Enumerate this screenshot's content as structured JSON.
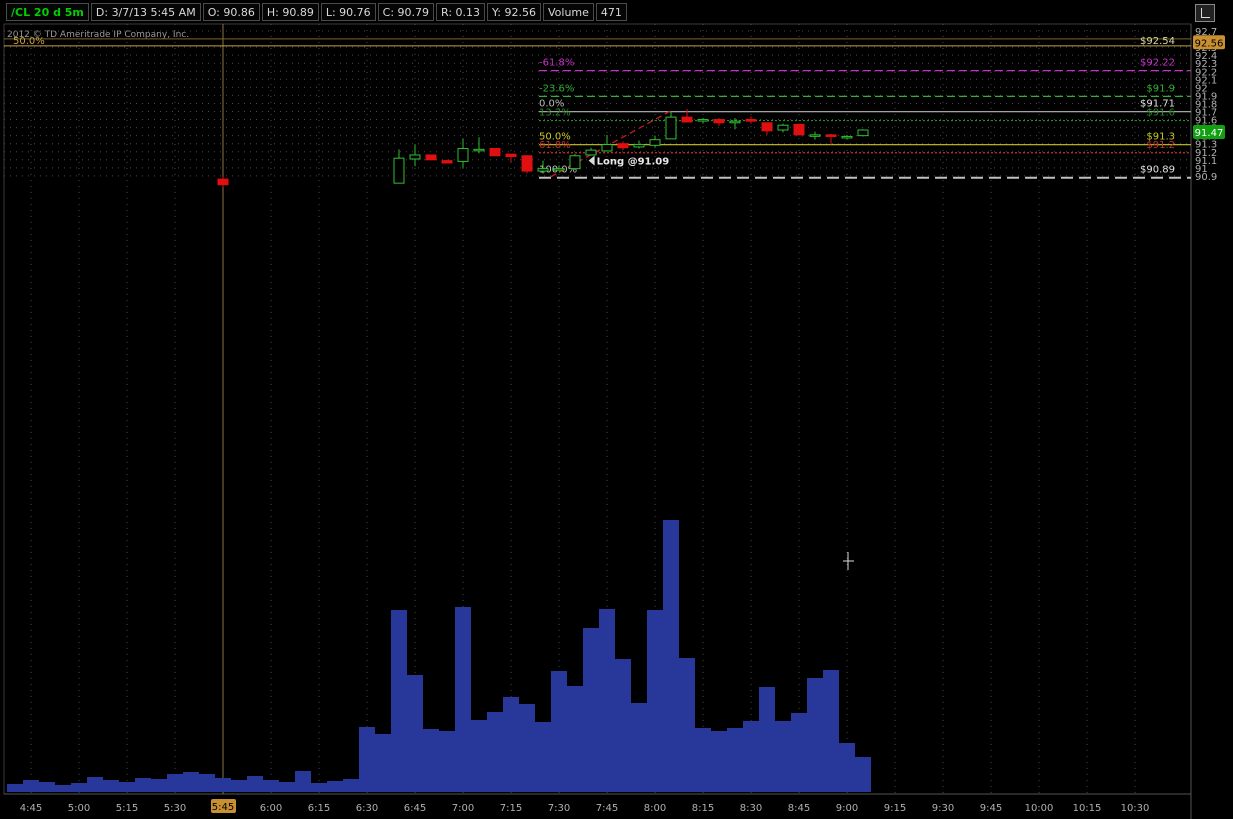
{
  "topbar": {
    "symbol": "/CL 20 d 5m",
    "date": "D: 3/7/13 5:45 AM",
    "open": "O: 90.86",
    "high": "H: 90.89",
    "low": "L: 90.76",
    "close": "C: 90.79",
    "range": "R: 0.13",
    "y": "Y: 92.56",
    "volume_label": "Volume",
    "volume_value": "471"
  },
  "copyright": "2012 © TD Ameritrade IP Company, Inc.",
  "chart_data": {
    "type": "candlestick",
    "price_range": [
      90.81,
      92.72
    ],
    "y_ticks": [
      "92.7",
      "92.6",
      "92.5",
      "92.4",
      "92.3",
      "92.2",
      "92.1",
      "92",
      "91.9",
      "91.8",
      "91.7",
      "91.6",
      "91.5",
      "91.4",
      "91.3",
      "91.2",
      "91.1",
      "91",
      "90.9"
    ],
    "x_ticks": [
      "4:45",
      "5:00",
      "5:15",
      "5:30",
      "5:45",
      "6:00",
      "6:15",
      "6:30",
      "6:45",
      "7:00",
      "7:15",
      "7:30",
      "7:45",
      "8:00",
      "8:15",
      "8:30",
      "8:45",
      "9:00",
      "9:15",
      "9:30",
      "9:45",
      "10:00",
      "10:15",
      "10:30"
    ],
    "cursor_time_label": "5:45",
    "candles": [
      {
        "time": "5:45",
        "o": 90.86,
        "h": 90.89,
        "l": 90.76,
        "c": 90.79
      },
      {
        "time": "6:40",
        "o": 90.81,
        "h": 91.23,
        "l": 90.81,
        "c": 91.12
      },
      {
        "time": "6:45",
        "o": 91.11,
        "h": 91.29,
        "l": 91.02,
        "c": 91.16
      },
      {
        "time": "6:50",
        "o": 91.16,
        "h": 91.16,
        "l": 91.1,
        "c": 91.1
      },
      {
        "time": "6:55",
        "o": 91.09,
        "h": 91.1,
        "l": 91.06,
        "c": 91.06
      },
      {
        "time": "7:00",
        "o": 91.08,
        "h": 91.36,
        "l": 91.0,
        "c": 91.24
      },
      {
        "time": "7:05",
        "o": 91.22,
        "h": 91.38,
        "l": 91.18,
        "c": 91.23
      },
      {
        "time": "7:10",
        "o": 91.24,
        "h": 91.24,
        "l": 91.15,
        "c": 91.15
      },
      {
        "time": "7:15",
        "o": 91.17,
        "h": 91.17,
        "l": 91.07,
        "c": 91.14
      },
      {
        "time": "7:20",
        "o": 91.15,
        "h": 91.16,
        "l": 90.93,
        "c": 90.96
      },
      {
        "time": "7:25",
        "o": 90.96,
        "h": 91.09,
        "l": 90.93,
        "c": 90.99
      },
      {
        "time": "7:30",
        "o": 90.99,
        "h": 91.03,
        "l": 90.97,
        "c": 90.99
      },
      {
        "time": "7:35",
        "o": 90.99,
        "h": 91.17,
        "l": 90.99,
        "c": 91.15
      },
      {
        "time": "7:40",
        "o": 91.16,
        "h": 91.25,
        "l": 91.16,
        "c": 91.22
      },
      {
        "time": "7:45",
        "o": 91.21,
        "h": 91.41,
        "l": 91.21,
        "c": 91.29
      },
      {
        "time": "7:50",
        "o": 91.3,
        "h": 91.33,
        "l": 91.22,
        "c": 91.25
      },
      {
        "time": "7:55",
        "o": 91.26,
        "h": 91.34,
        "l": 91.24,
        "c": 91.29
      },
      {
        "time": "8:00",
        "o": 91.28,
        "h": 91.4,
        "l": 91.25,
        "c": 91.35
      },
      {
        "time": "8:05",
        "o": 91.36,
        "h": 91.7,
        "l": 91.36,
        "c": 91.63
      },
      {
        "time": "8:10",
        "o": 91.63,
        "h": 91.73,
        "l": 91.57,
        "c": 91.57
      },
      {
        "time": "8:15",
        "o": 91.59,
        "h": 91.62,
        "l": 91.55,
        "c": 91.6
      },
      {
        "time": "8:20",
        "o": 91.6,
        "h": 91.62,
        "l": 91.52,
        "c": 91.56
      },
      {
        "time": "8:25",
        "o": 91.56,
        "h": 91.62,
        "l": 91.48,
        "c": 91.58
      },
      {
        "time": "8:30",
        "o": 91.6,
        "h": 91.64,
        "l": 91.55,
        "c": 91.58
      },
      {
        "time": "8:35",
        "o": 91.56,
        "h": 91.56,
        "l": 91.41,
        "c": 91.46
      },
      {
        "time": "8:40",
        "o": 91.47,
        "h": 91.55,
        "l": 91.44,
        "c": 91.53
      },
      {
        "time": "8:45",
        "o": 91.54,
        "h": 91.55,
        "l": 91.41,
        "c": 91.41
      },
      {
        "time": "8:50",
        "o": 91.4,
        "h": 91.45,
        "l": 91.35,
        "c": 91.41
      },
      {
        "time": "8:55",
        "o": 91.41,
        "h": 91.42,
        "l": 91.29,
        "c": 91.39
      },
      {
        "time": "9:00",
        "o": 91.39,
        "h": 91.41,
        "l": 91.35,
        "c": 91.39
      },
      {
        "time": "9:05",
        "o": 91.4,
        "h": 91.48,
        "l": 91.39,
        "c": 91.47
      }
    ],
    "volume_bars": [
      {
        "time": "4:40",
        "v": 8
      },
      {
        "time": "4:45",
        "v": 12
      },
      {
        "time": "4:50",
        "v": 10
      },
      {
        "time": "4:55",
        "v": 7
      },
      {
        "time": "5:00",
        "v": 9
      },
      {
        "time": "5:05",
        "v": 15
      },
      {
        "time": "5:10",
        "v": 12
      },
      {
        "time": "5:15",
        "v": 10
      },
      {
        "time": "5:20",
        "v": 14
      },
      {
        "time": "5:25",
        "v": 13
      },
      {
        "time": "5:30",
        "v": 18
      },
      {
        "time": "5:35",
        "v": 20
      },
      {
        "time": "5:40",
        "v": 18
      },
      {
        "time": "5:45",
        "v": 14
      },
      {
        "time": "5:50",
        "v": 12
      },
      {
        "time": "5:55",
        "v": 16
      },
      {
        "time": "6:00",
        "v": 12
      },
      {
        "time": "6:05",
        "v": 10
      },
      {
        "time": "6:10",
        "v": 21
      },
      {
        "time": "6:15",
        "v": 9
      },
      {
        "time": "6:20",
        "v": 11
      },
      {
        "time": "6:25",
        "v": 13
      },
      {
        "time": "6:30",
        "v": 65
      },
      {
        "time": "6:35",
        "v": 58
      },
      {
        "time": "6:40",
        "v": 182
      },
      {
        "time": "6:45",
        "v": 117
      },
      {
        "time": "6:50",
        "v": 63
      },
      {
        "time": "6:55",
        "v": 61
      },
      {
        "time": "7:00",
        "v": 185
      },
      {
        "time": "7:05",
        "v": 72
      },
      {
        "time": "7:10",
        "v": 80
      },
      {
        "time": "7:15",
        "v": 95
      },
      {
        "time": "7:20",
        "v": 88
      },
      {
        "time": "7:25",
        "v": 70
      },
      {
        "time": "7:30",
        "v": 121
      },
      {
        "time": "7:35",
        "v": 106
      },
      {
        "time": "7:40",
        "v": 164
      },
      {
        "time": "7:45",
        "v": 183
      },
      {
        "time": "7:50",
        "v": 133
      },
      {
        "time": "7:55",
        "v": 89
      },
      {
        "time": "8:00",
        "v": 182
      },
      {
        "time": "8:05",
        "v": 272
      },
      {
        "time": "8:10",
        "v": 134
      },
      {
        "time": "8:15",
        "v": 64
      },
      {
        "time": "8:20",
        "v": 61
      },
      {
        "time": "8:25",
        "v": 64
      },
      {
        "time": "8:30",
        "v": 71
      },
      {
        "time": "8:35",
        "v": 105
      },
      {
        "time": "8:40",
        "v": 71
      },
      {
        "time": "8:45",
        "v": 79
      },
      {
        "time": "8:50",
        "v": 114
      },
      {
        "time": "8:55",
        "v": 122
      },
      {
        "time": "9:00",
        "v": 49
      },
      {
        "time": "9:05",
        "v": 35
      }
    ],
    "fibonacci": [
      {
        "label": "-61.8%",
        "price": 92.22,
        "price_label": "$92.22",
        "color": "#c830c8",
        "style": "dashed"
      },
      {
        "label": "-23.6%",
        "price": 91.9,
        "price_label": "$91.9",
        "color": "#30b030",
        "style": "dashed"
      },
      {
        "label": "0.0%",
        "price": 91.71,
        "price_label": "$91.71",
        "color": "#b8b8b8",
        "style": "solid"
      },
      {
        "label": "13.2%",
        "price": 91.6,
        "price_label": "$91.6",
        "color": "#2a8a2a",
        "style": "dotted"
      },
      {
        "label": "50.0%",
        "price": 91.3,
        "price_label": "$91.3",
        "color": "#c8c820",
        "style": "solid"
      },
      {
        "label": "61.8%",
        "price": 91.2,
        "price_label": "$91.2",
        "color": "#c83030",
        "style": "dotted"
      },
      {
        "label": "100.0%",
        "price": 90.89,
        "price_label": "$90.89",
        "color": "#c0c0c0",
        "style": "longdash"
      }
    ],
    "top_line": {
      "label": "50.0%",
      "price": 92.54,
      "price_label": "$92.54",
      "color": "#c8a040"
    },
    "y_marker": {
      "label": "92.56",
      "price": 92.56,
      "color": "#c89030"
    },
    "last_price_marker": {
      "label": "91.47",
      "price": 91.47,
      "color": "#10a010"
    },
    "trendline": {
      "from": {
        "time": "7:25",
        "price": 90.89
      },
      "to": {
        "time": "8:05",
        "price": 91.71
      },
      "color": "#d02020"
    },
    "annotation": {
      "label": "Long @91.09",
      "time": "7:38",
      "price": 91.09
    },
    "volume_max": 280,
    "grid": true,
    "colors": {
      "up": "#30c030",
      "down": "#e01010",
      "volume": "#28389a",
      "grid": "#4a4a4a",
      "axis_text": "#b0b0b0",
      "background": "#000000"
    }
  }
}
